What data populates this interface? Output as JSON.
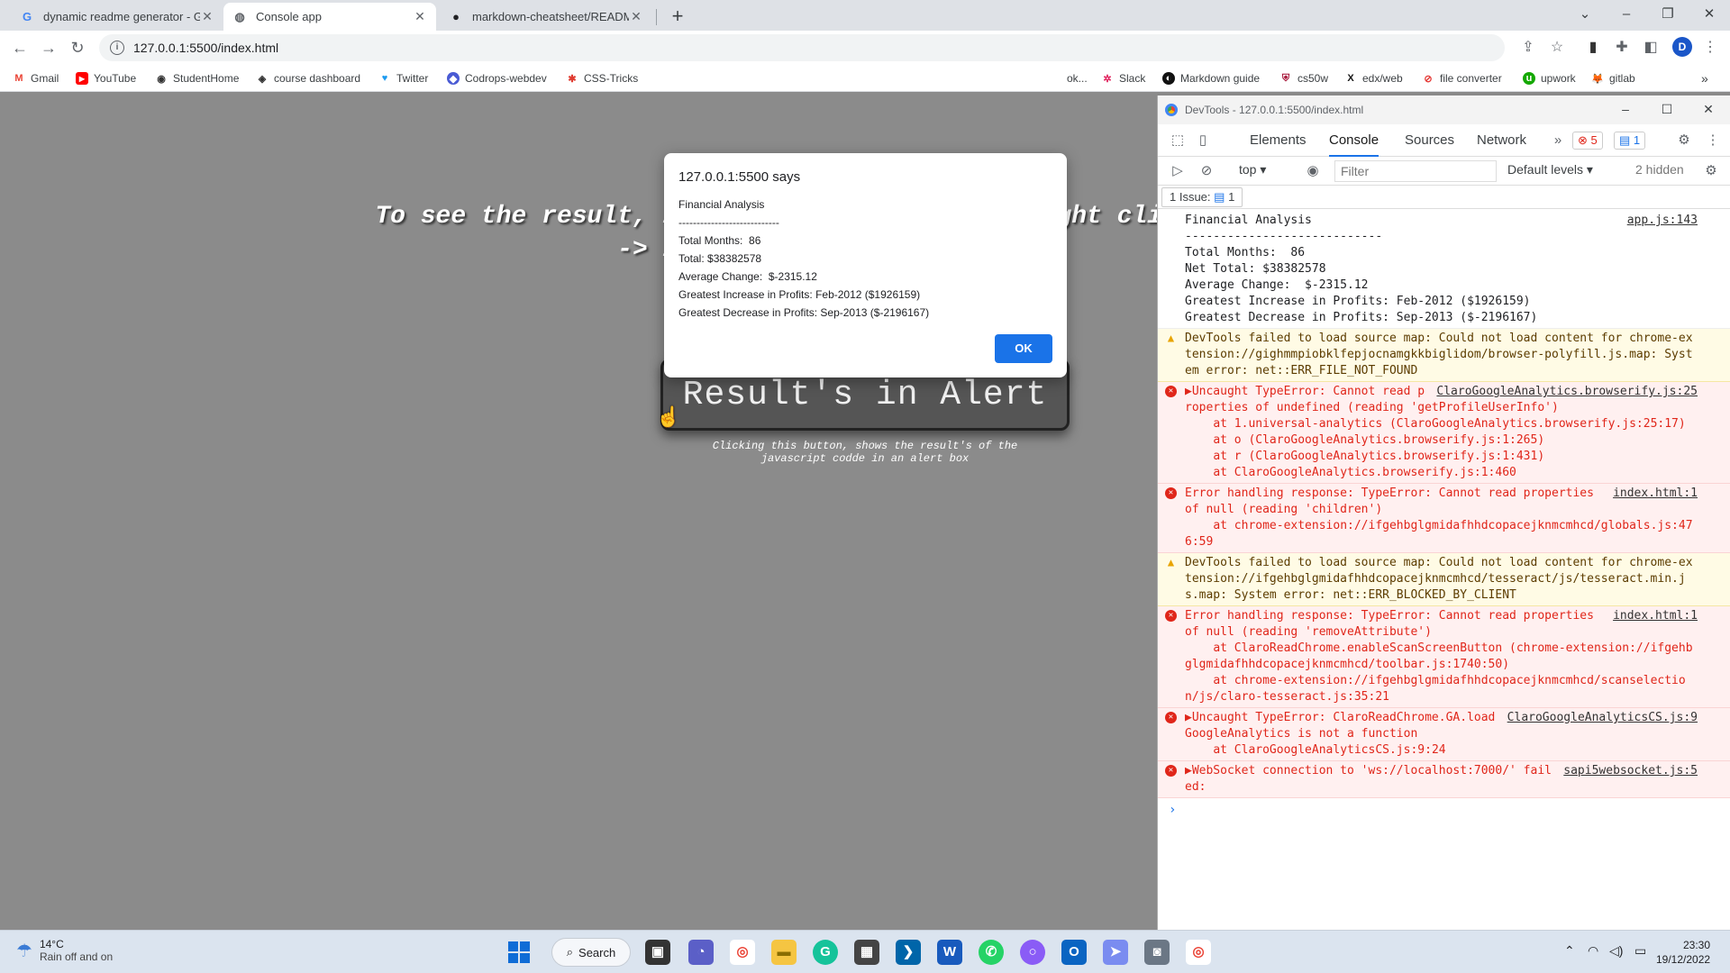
{
  "tabs": [
    {
      "title": "dynamic readme generator - Goo",
      "favicon": "G"
    },
    {
      "title": "Console app",
      "favicon": "globe"
    },
    {
      "title": "markdown-cheatsheet/README.",
      "favicon": "github"
    }
  ],
  "url": "127.0.0.1:5500/index.html",
  "profile_initial": "D",
  "bookmarks": [
    "Gmail",
    "YouTube",
    "StudentHome",
    "course dashboard",
    "Twitter",
    "Codrops-webdev",
    "CSS-Tricks",
    "ok...",
    "Slack",
    "Markdown guide",
    "cs50w",
    "edx/web",
    "file converter",
    "upwork",
    "gitlab"
  ],
  "page": {
    "instruction": "To see the result, inspect the page in the right click -> inspect -> console.",
    "button_label": "Result's in Alert",
    "caption": "Clicking this button, shows the result's of the javascript codde in an alert box"
  },
  "alert": {
    "host": "127.0.0.1:5500 says",
    "lines": [
      "Financial Analysis",
      "----------------------------",
      "Total Months:  86",
      "Total: $38382578",
      "Average Change:  $-2315.12",
      "Greatest Increase in Profits: Feb-2012 ($1926159)",
      "Greatest Decrease in Profits: Sep-2013 ($-2196167)"
    ],
    "ok": "OK"
  },
  "devtools": {
    "title": "DevTools - 127.0.0.1:5500/index.html",
    "tabs": [
      "Elements",
      "Console",
      "Sources",
      "Network"
    ],
    "error_count": "5",
    "issue_count": "1",
    "context": "top",
    "filter_placeholder": "Filter",
    "levels": "Default levels",
    "hidden": "2 hidden",
    "issues_label": "1 Issue:",
    "issues_badge": "1",
    "log": {
      "src": "app.js:143",
      "text": "Financial Analysis\n----------------------------\nTotal Months:  86\nNet Total: $38382578\nAverage Change:  $-2315.12\nGreatest Increase in Profits: Feb-2012 ($1926159)\nGreatest Decrease in Profits: Sep-2013 ($-2196167)"
    },
    "messages": [
      {
        "level": "warn",
        "src": "",
        "text": "DevTools failed to load source map: Could not load content for chrome-extension://gighmmpiobklfepjocnamgkkbiglidom/browser-polyfill.js.map: System error: net::ERR_FILE_NOT_FOUND"
      },
      {
        "level": "err",
        "src": "ClaroGoogleAnalytics.browserify.js:25",
        "text": "▶Uncaught TypeError: Cannot read properties of undefined (reading 'getProfileUserInfo')\n    at 1.universal-analytics (ClaroGoogleAnalytics.browserify.js:25:17)\n    at o (ClaroGoogleAnalytics.browserify.js:1:265)\n    at r (ClaroGoogleAnalytics.browserify.js:1:431)\n    at ClaroGoogleAnalytics.browserify.js:1:460"
      },
      {
        "level": "err",
        "src": "index.html:1",
        "text": "Error handling response: TypeError: Cannot read properties of null (reading 'children')\n    at chrome-extension://ifgehbglgmidafhhdcopacejknmcmhcd/globals.js:476:59"
      },
      {
        "level": "warn",
        "src": "",
        "text": "DevTools failed to load source map: Could not load content for chrome-extension://ifgehbglgmidafhhdcopacejknmcmhcd/tesseract/js/tesseract.min.js.map: System error: net::ERR_BLOCKED_BY_CLIENT"
      },
      {
        "level": "err",
        "src": "index.html:1",
        "text": "Error handling response: TypeError: Cannot read properties of null (reading 'removeAttribute')\n    at ClaroReadChrome.enableScanScreenButton (chrome-extension://ifgehbglgmidafhhdcopacejknmcmhcd/toolbar.js:1740:50)\n    at chrome-extension://ifgehbglgmidafhhdcopacejknmcmhcd/scanselection/js/claro-tesseract.js:35:21"
      },
      {
        "level": "err",
        "src": "ClaroGoogleAnalyticsCS.js:9",
        "text": "▶Uncaught TypeError: ClaroReadChrome.GA.loadGoogleAnalytics is not a function\n    at ClaroGoogleAnalyticsCS.js:9:24"
      },
      {
        "level": "err",
        "src": "sapi5websocket.js:5",
        "text": "▶WebSocket connection to 'ws://localhost:7000/' failed:"
      }
    ],
    "prompt": "›"
  },
  "taskbar": {
    "temp": "14°C",
    "weather": "Rain off and on",
    "search": "Search",
    "time": "23:30",
    "date": "19/12/2022"
  }
}
